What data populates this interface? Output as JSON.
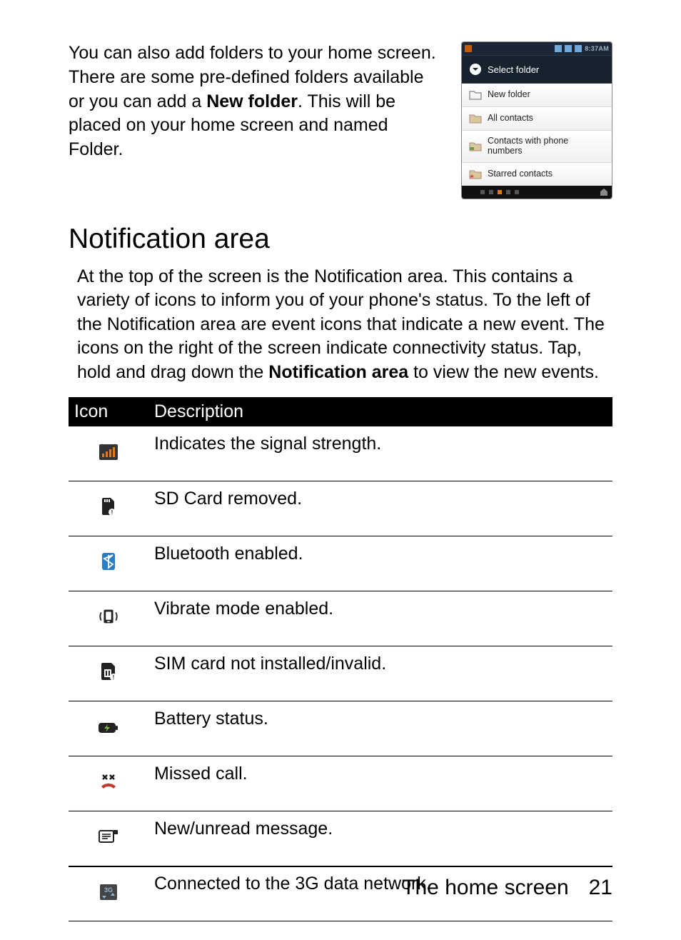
{
  "intro": {
    "before_bold": "You can also add folders to your home screen. There are some pre-defined folders available or you can add a ",
    "bold": "New folder",
    "after_bold": ". This will be placed on your home screen and named Folder."
  },
  "mockup": {
    "status_time": "8:37AM",
    "header": "Select folder",
    "items": [
      "New folder",
      "All contacts",
      "Contacts with phone numbers",
      "Starred contacts"
    ]
  },
  "section_heading": "Notification area",
  "section_body": {
    "p1": "At the top of the screen is the Notification area. This contains a variety of icons to inform you of your phone's status. To the left of the Notification area are event icons that indicate a new event. The icons on the right of the screen indicate connectivity status. Tap, hold and drag down the ",
    "bold": "Notification area",
    "p2": " to view the new events."
  },
  "table": {
    "headers": [
      "Icon",
      "Description"
    ],
    "rows": [
      {
        "icon": "signal-strength-icon",
        "desc": "Indicates the signal strength."
      },
      {
        "icon": "sd-card-removed-icon",
        "desc": "SD Card removed."
      },
      {
        "icon": "bluetooth-icon",
        "desc": "Bluetooth enabled."
      },
      {
        "icon": "vibrate-icon",
        "desc": "Vibrate mode enabled."
      },
      {
        "icon": "sim-invalid-icon",
        "desc": "SIM card not installed/invalid."
      },
      {
        "icon": "battery-icon",
        "desc": "Battery status."
      },
      {
        "icon": "missed-call-icon",
        "desc": "Missed call."
      },
      {
        "icon": "new-message-icon",
        "desc": "New/unread message."
      },
      {
        "icon": "3g-network-icon",
        "desc": "Connected to the 3G data network."
      }
    ]
  },
  "footer": {
    "title": "The home screen",
    "page": "21"
  }
}
